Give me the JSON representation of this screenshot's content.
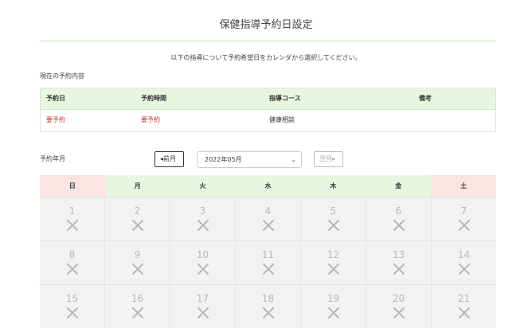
{
  "page": {
    "title": "保健指導予約日設定",
    "instruction": "以下の指導について予約希望日をカレンダから選択してください。"
  },
  "reservation": {
    "section_label": "現在の予約内容",
    "headers": [
      "予約日",
      "予約時間",
      "指導コース",
      "備考"
    ],
    "row": {
      "date": "要予約",
      "time": "要予約",
      "course": "健康相談",
      "note": ""
    }
  },
  "calendar_nav": {
    "label": "予約年月",
    "prev_label": "前月",
    "next_label": "翌月",
    "selected_month": "2022年05月"
  },
  "calendar": {
    "weekdays": [
      "日",
      "月",
      "火",
      "水",
      "木",
      "金",
      "土"
    ],
    "weeks": [
      [
        "1",
        "2",
        "3",
        "4",
        "5",
        "6",
        "7"
      ],
      [
        "8",
        "9",
        "10",
        "11",
        "12",
        "13",
        "14"
      ],
      [
        "15",
        "16",
        "17",
        "18",
        "19",
        "20",
        "21"
      ]
    ],
    "unavailable_icon": "cross-icon"
  },
  "colors": {
    "accent_green": "#e8f6e0",
    "weekend_pink": "#fce4e4",
    "required_red": "#c0392b"
  }
}
